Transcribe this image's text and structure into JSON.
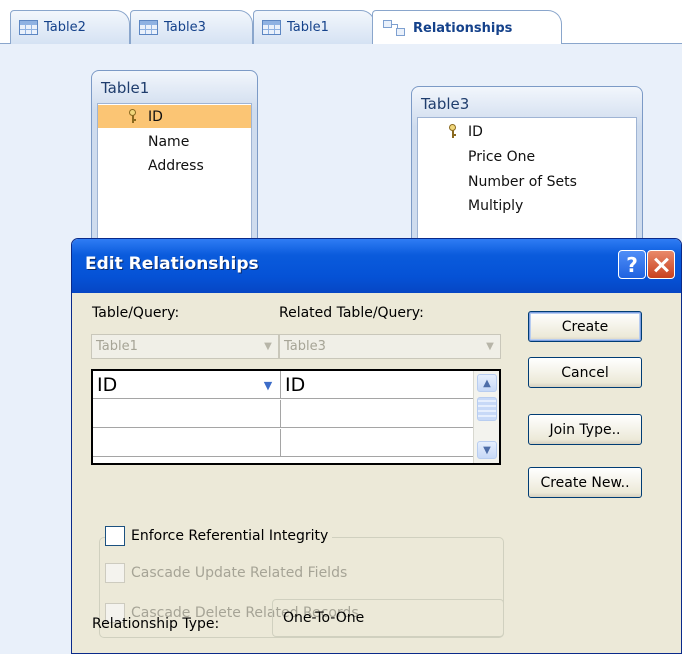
{
  "tabs": [
    {
      "label": "Table2",
      "icon": "table-icon"
    },
    {
      "label": "Table3",
      "icon": "table-icon"
    },
    {
      "label": "Table1",
      "icon": "table-icon"
    },
    {
      "label": "Relationships",
      "icon": "relationships-icon",
      "active": true
    }
  ],
  "tables": {
    "table1": {
      "title": "Table1",
      "fields": [
        "ID",
        "Name",
        "Address"
      ],
      "primary_key": "ID",
      "selected_field": "ID"
    },
    "table3": {
      "title": "Table3",
      "fields": [
        "ID",
        "Price One",
        "Number of Sets",
        "Multiply"
      ],
      "primary_key": "ID"
    }
  },
  "dialog": {
    "title": "Edit Relationships",
    "help_button": "?",
    "table_query_label": "Table/Query:",
    "related_table_query_label": "Related Table/Query:",
    "table_query_value": "Table1",
    "related_table_query_value": "Table3",
    "field_rows": [
      {
        "left": "ID",
        "right": "ID"
      },
      {
        "left": "",
        "right": ""
      },
      {
        "left": "",
        "right": ""
      }
    ],
    "buttons": {
      "create": "Create",
      "cancel": "Cancel",
      "join_type": "Join Type..",
      "create_new": "Create New.."
    },
    "enforce_integrity": {
      "label": "Enforce Referential Integrity",
      "checked": false
    },
    "cascade_update": {
      "label": "Cascade Update Related Fields",
      "checked": false,
      "enabled": false
    },
    "cascade_delete": {
      "label": "Cascade Delete Related Records",
      "checked": false,
      "enabled": false
    },
    "relationship_type_label": "Relationship Type:",
    "relationship_type_value": "One-To-One"
  },
  "colors": {
    "title_bar": "#0552d6",
    "selected_field": "#fbc574",
    "dialog_bg": "#ece9d8"
  }
}
